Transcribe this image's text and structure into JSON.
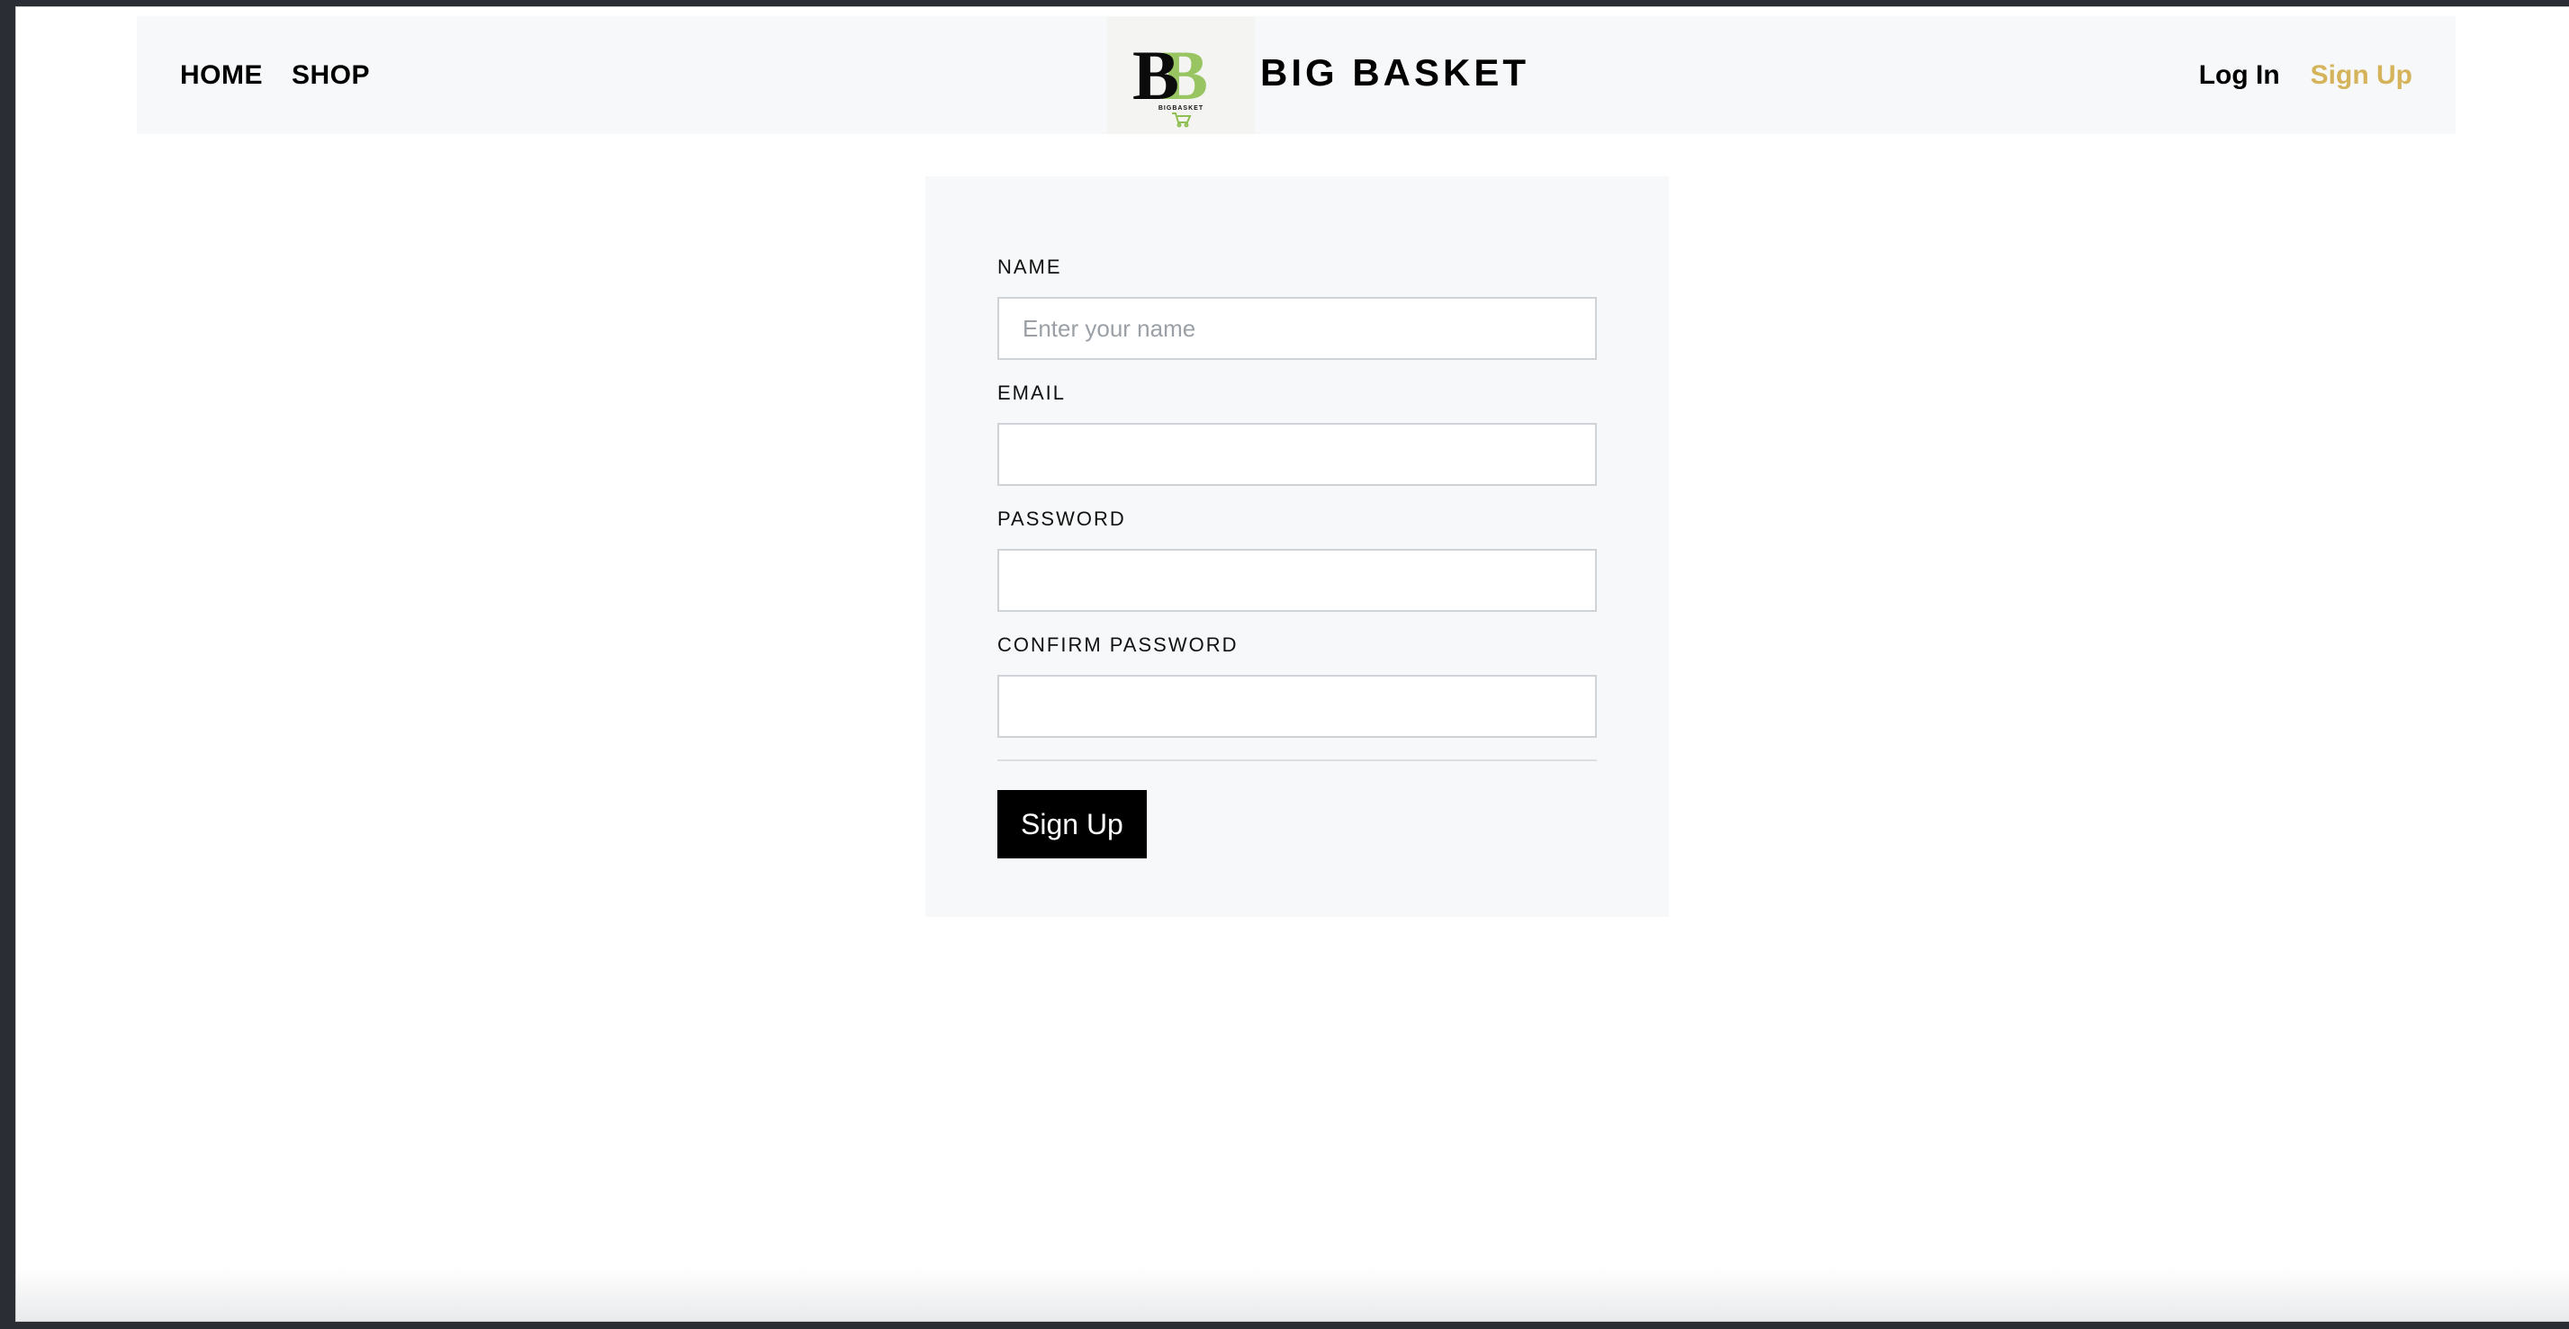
{
  "navbar": {
    "links": [
      "HOME",
      "SHOP"
    ],
    "brand_name": "BIG BASKET",
    "login_label": "Log In",
    "signup_label": "Sign Up",
    "signup_color": "#d4b35a",
    "logo_text": "BB",
    "logo_subtext": "BIGBASKET",
    "logo_accent": "#8fbf52"
  },
  "form": {
    "fields": [
      {
        "label": "NAME",
        "placeholder": "Enter your name",
        "value": ""
      },
      {
        "label": "EMAIL",
        "placeholder": "",
        "value": ""
      },
      {
        "label": "PASSWORD",
        "placeholder": "",
        "value": ""
      },
      {
        "label": "CONFIRM PASSWORD",
        "placeholder": "",
        "value": ""
      }
    ],
    "submit_label": "Sign Up"
  }
}
